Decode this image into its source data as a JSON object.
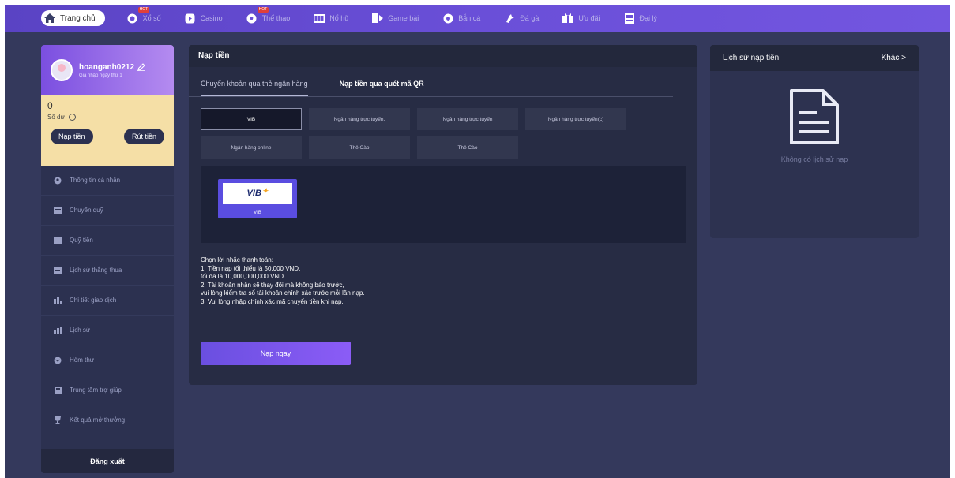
{
  "nav": {
    "home": "Trang chủ",
    "items": [
      {
        "label": "Xổ số",
        "icon": "lottery-icon",
        "hot": true
      },
      {
        "label": "Casino",
        "icon": "casino-icon",
        "hot": false
      },
      {
        "label": "Thể thao",
        "icon": "soccer-icon",
        "hot": true
      },
      {
        "label": "Nổ hũ",
        "icon": "slot-icon",
        "hot": false
      },
      {
        "label": "Game bài",
        "icon": "cards-icon",
        "hot": false
      },
      {
        "label": "Bắn cá",
        "icon": "fish-icon",
        "hot": false
      },
      {
        "label": "Đá gà",
        "icon": "rooster-icon",
        "hot": false
      },
      {
        "label": "Ưu đãi",
        "icon": "gift-icon",
        "hot": false
      },
      {
        "label": "Đại lý",
        "icon": "agent-icon",
        "hot": false
      }
    ],
    "hot_badge": "HOT"
  },
  "user": {
    "username": "hoanganh0212",
    "subtitle": "Gia nhập ngày thứ 1",
    "balance": "0",
    "balance_label": "Số dư",
    "deposit_btn": "Nạp tiền",
    "withdraw_btn": "Rút tiền"
  },
  "menu": [
    {
      "label": "Thông tin cá nhân",
      "icon": "user-icon"
    },
    {
      "label": "Chuyển quỹ",
      "icon": "transfer-icon"
    },
    {
      "label": "Quỹ tiền",
      "icon": "wallet-icon"
    },
    {
      "label": "Lịch sử thắng thua",
      "icon": "history-icon"
    },
    {
      "label": "Chi tiết giao dịch",
      "icon": "chart-icon"
    },
    {
      "label": "Lịch sử",
      "icon": "bars-icon"
    },
    {
      "label": "Hòm thư",
      "icon": "mail-icon"
    },
    {
      "label": "Trung tâm trợ giúp",
      "icon": "help-icon"
    },
    {
      "label": "Kết quả mở thưởng",
      "icon": "trophy-icon"
    }
  ],
  "logout": "Đăng xuất",
  "main": {
    "title": "Nạp tiền",
    "tabs": [
      "Chuyển khoản qua thẻ ngân hàng",
      "Nạp tiền qua quét mã QR"
    ],
    "banks": [
      "VIB",
      "Ngân hàng trực tuyến.",
      "Ngân hàng trực tuyến",
      "Ngân hàng trực tuyến(c)",
      "Ngân hàng online",
      "Thẻ Cào",
      "Thẻ Cào"
    ],
    "selected_bank_logo": "VIB",
    "selected_bank_name": "VIB",
    "notes": [
      "Chọn lời nhắc thanh toán:",
      "1. Tiền nạp tối thiểu là 50,000 VND,",
      "tối đa là 10,000,000,000 VND.",
      "2. Tài khoản nhận sẽ thay đổi mà không báo trước,",
      "vui lòng kiểm tra số tài khoản chính xác trước mỗi lần nạp.",
      "3. Vui lòng nhập chính xác mã chuyển tiền khi nạp."
    ],
    "submit": "Nạp ngay"
  },
  "history": {
    "title": "Lịch sử nạp tiền",
    "more": "Khác >",
    "empty": "Không có lịch sử nạp"
  },
  "colors": {
    "nav_bg": "#6a4fd8",
    "page_bg": "#34395c",
    "accent": "#7b4fe0",
    "balance_bg": "#f5dfa6"
  }
}
